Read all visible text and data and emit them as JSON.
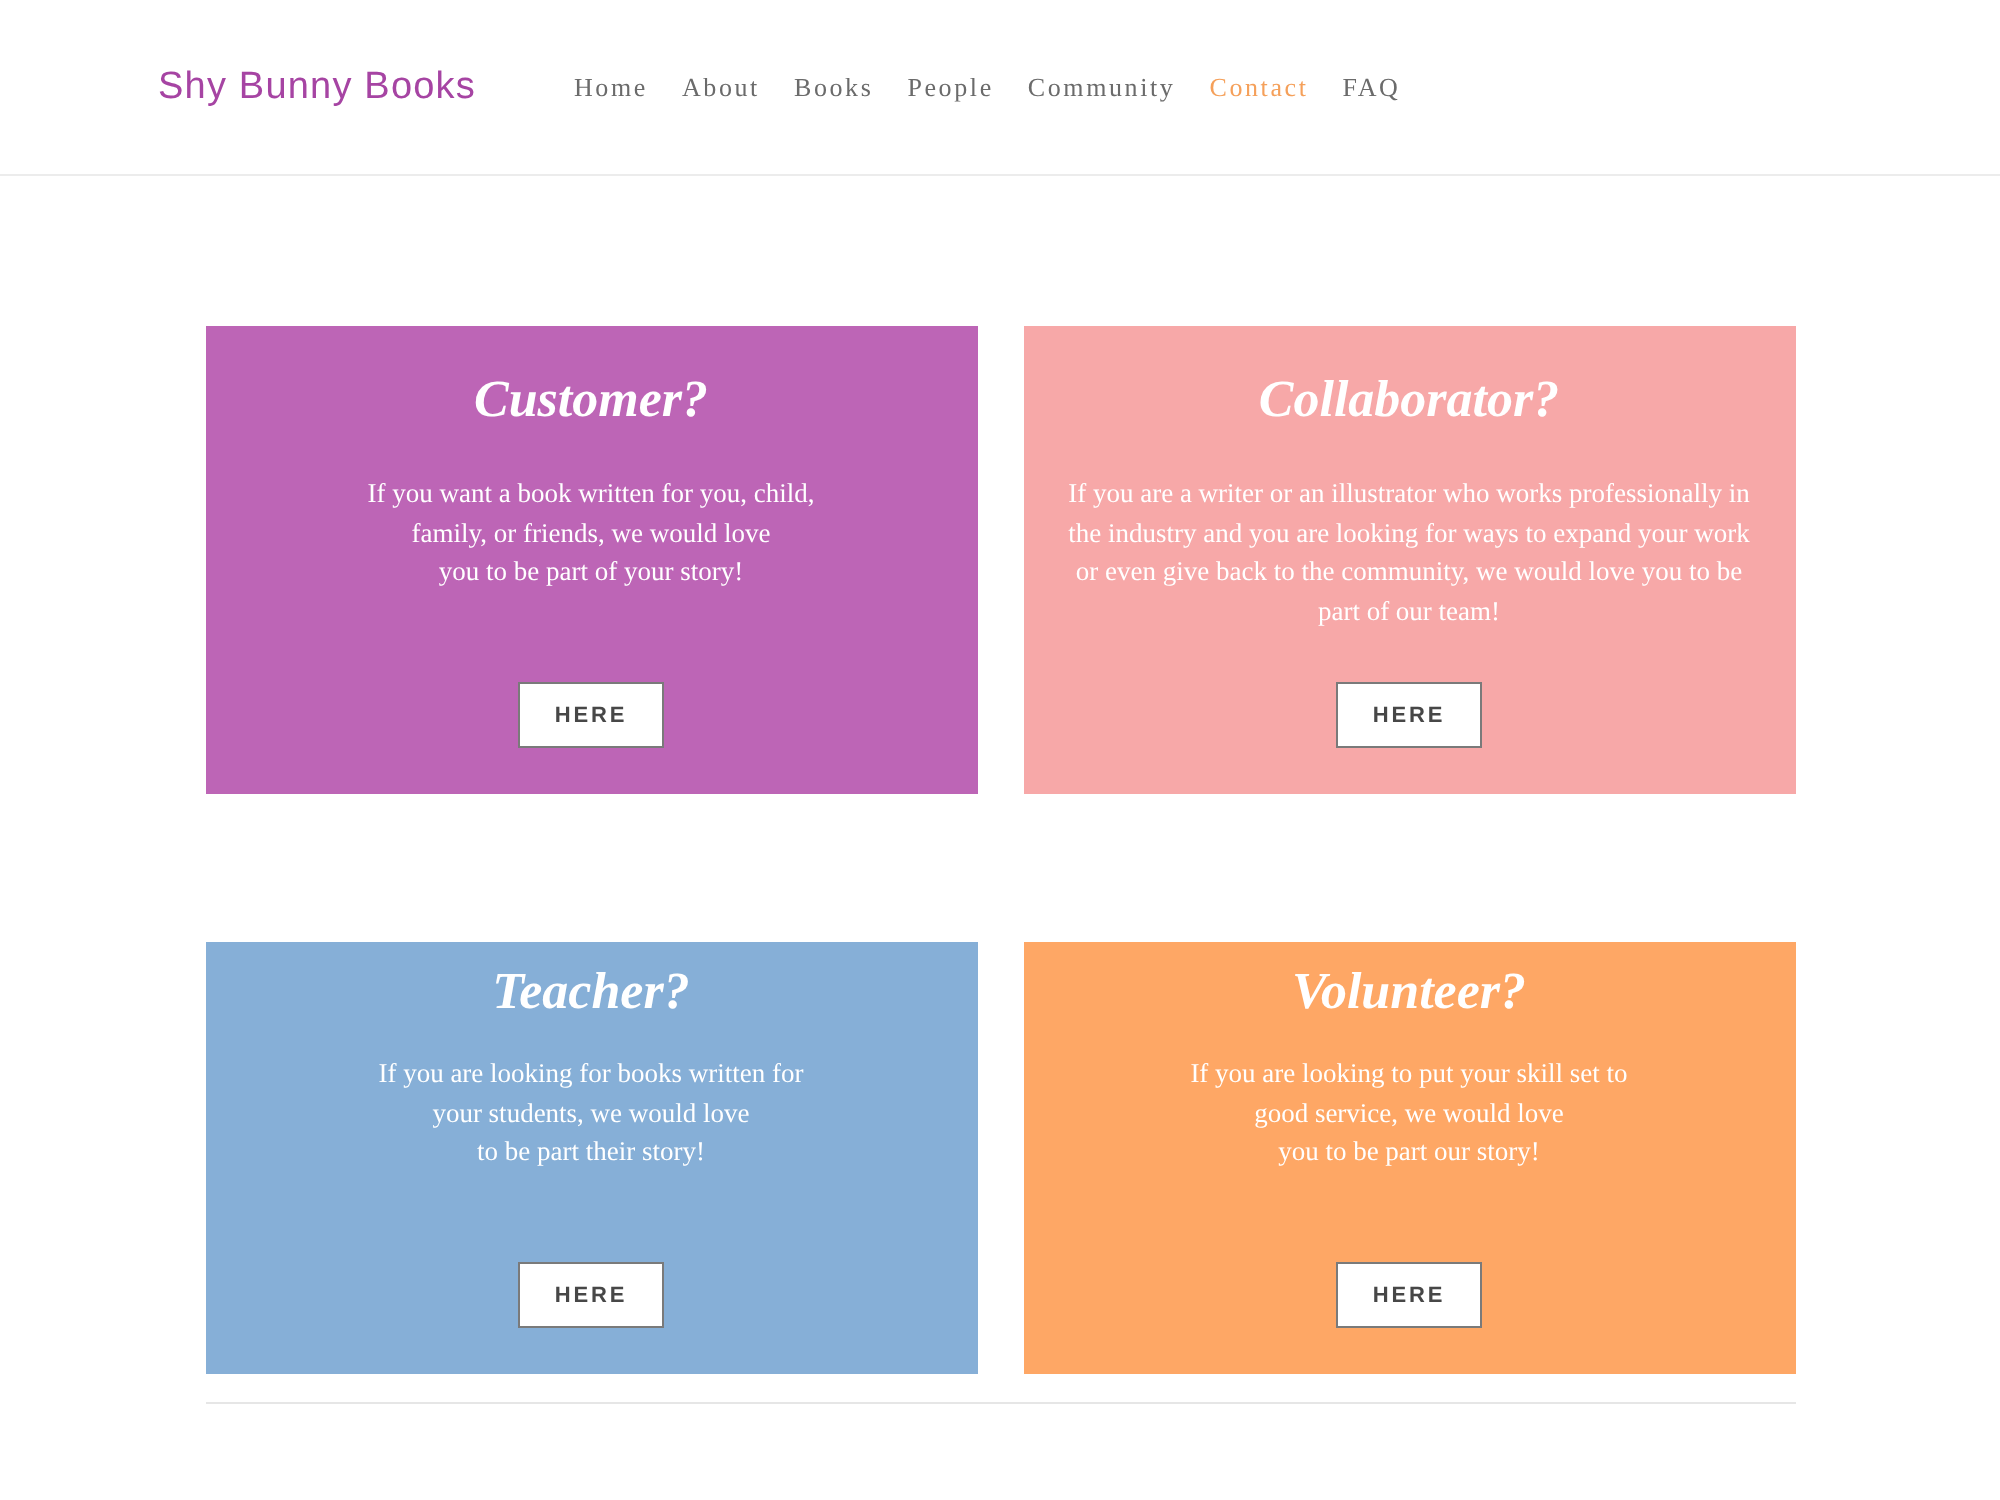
{
  "header": {
    "logo": "Shy Bunny Books"
  },
  "nav": [
    {
      "label": "Home",
      "selected": false
    },
    {
      "label": "About",
      "selected": false
    },
    {
      "label": "Books",
      "selected": false
    },
    {
      "label": "People",
      "selected": false
    },
    {
      "label": "Community",
      "selected": false
    },
    {
      "label": "Contact",
      "selected": true
    },
    {
      "label": "FAQ",
      "selected": false
    }
  ],
  "cards": [
    {
      "title": "Customer?",
      "text": "If you want a book written for you, child,\nfamily, or friends, we would love\nyou to be part of your story!",
      "button": "HERE",
      "color": "#bd65b6"
    },
    {
      "title": "Collaborator?",
      "text": "If you are a writer or an illustrator who works professionally in\nthe industry and you are looking for ways to expand your work\nor even give back to the community, we would love you to be\npart of our team!",
      "button": "HERE",
      "color": "#f7a8a8"
    },
    {
      "title": "Teacher?",
      "text": "If you are looking for books written for\nyour students, we would love\nto be part their story!",
      "button": "HERE",
      "color": "#86afd7"
    },
    {
      "title": "Volunteer?",
      "text": "If you are looking to put your skill set to\ngood service, we would love\nyou to be part our story!",
      "button": "HERE",
      "color": "#fea765"
    }
  ]
}
